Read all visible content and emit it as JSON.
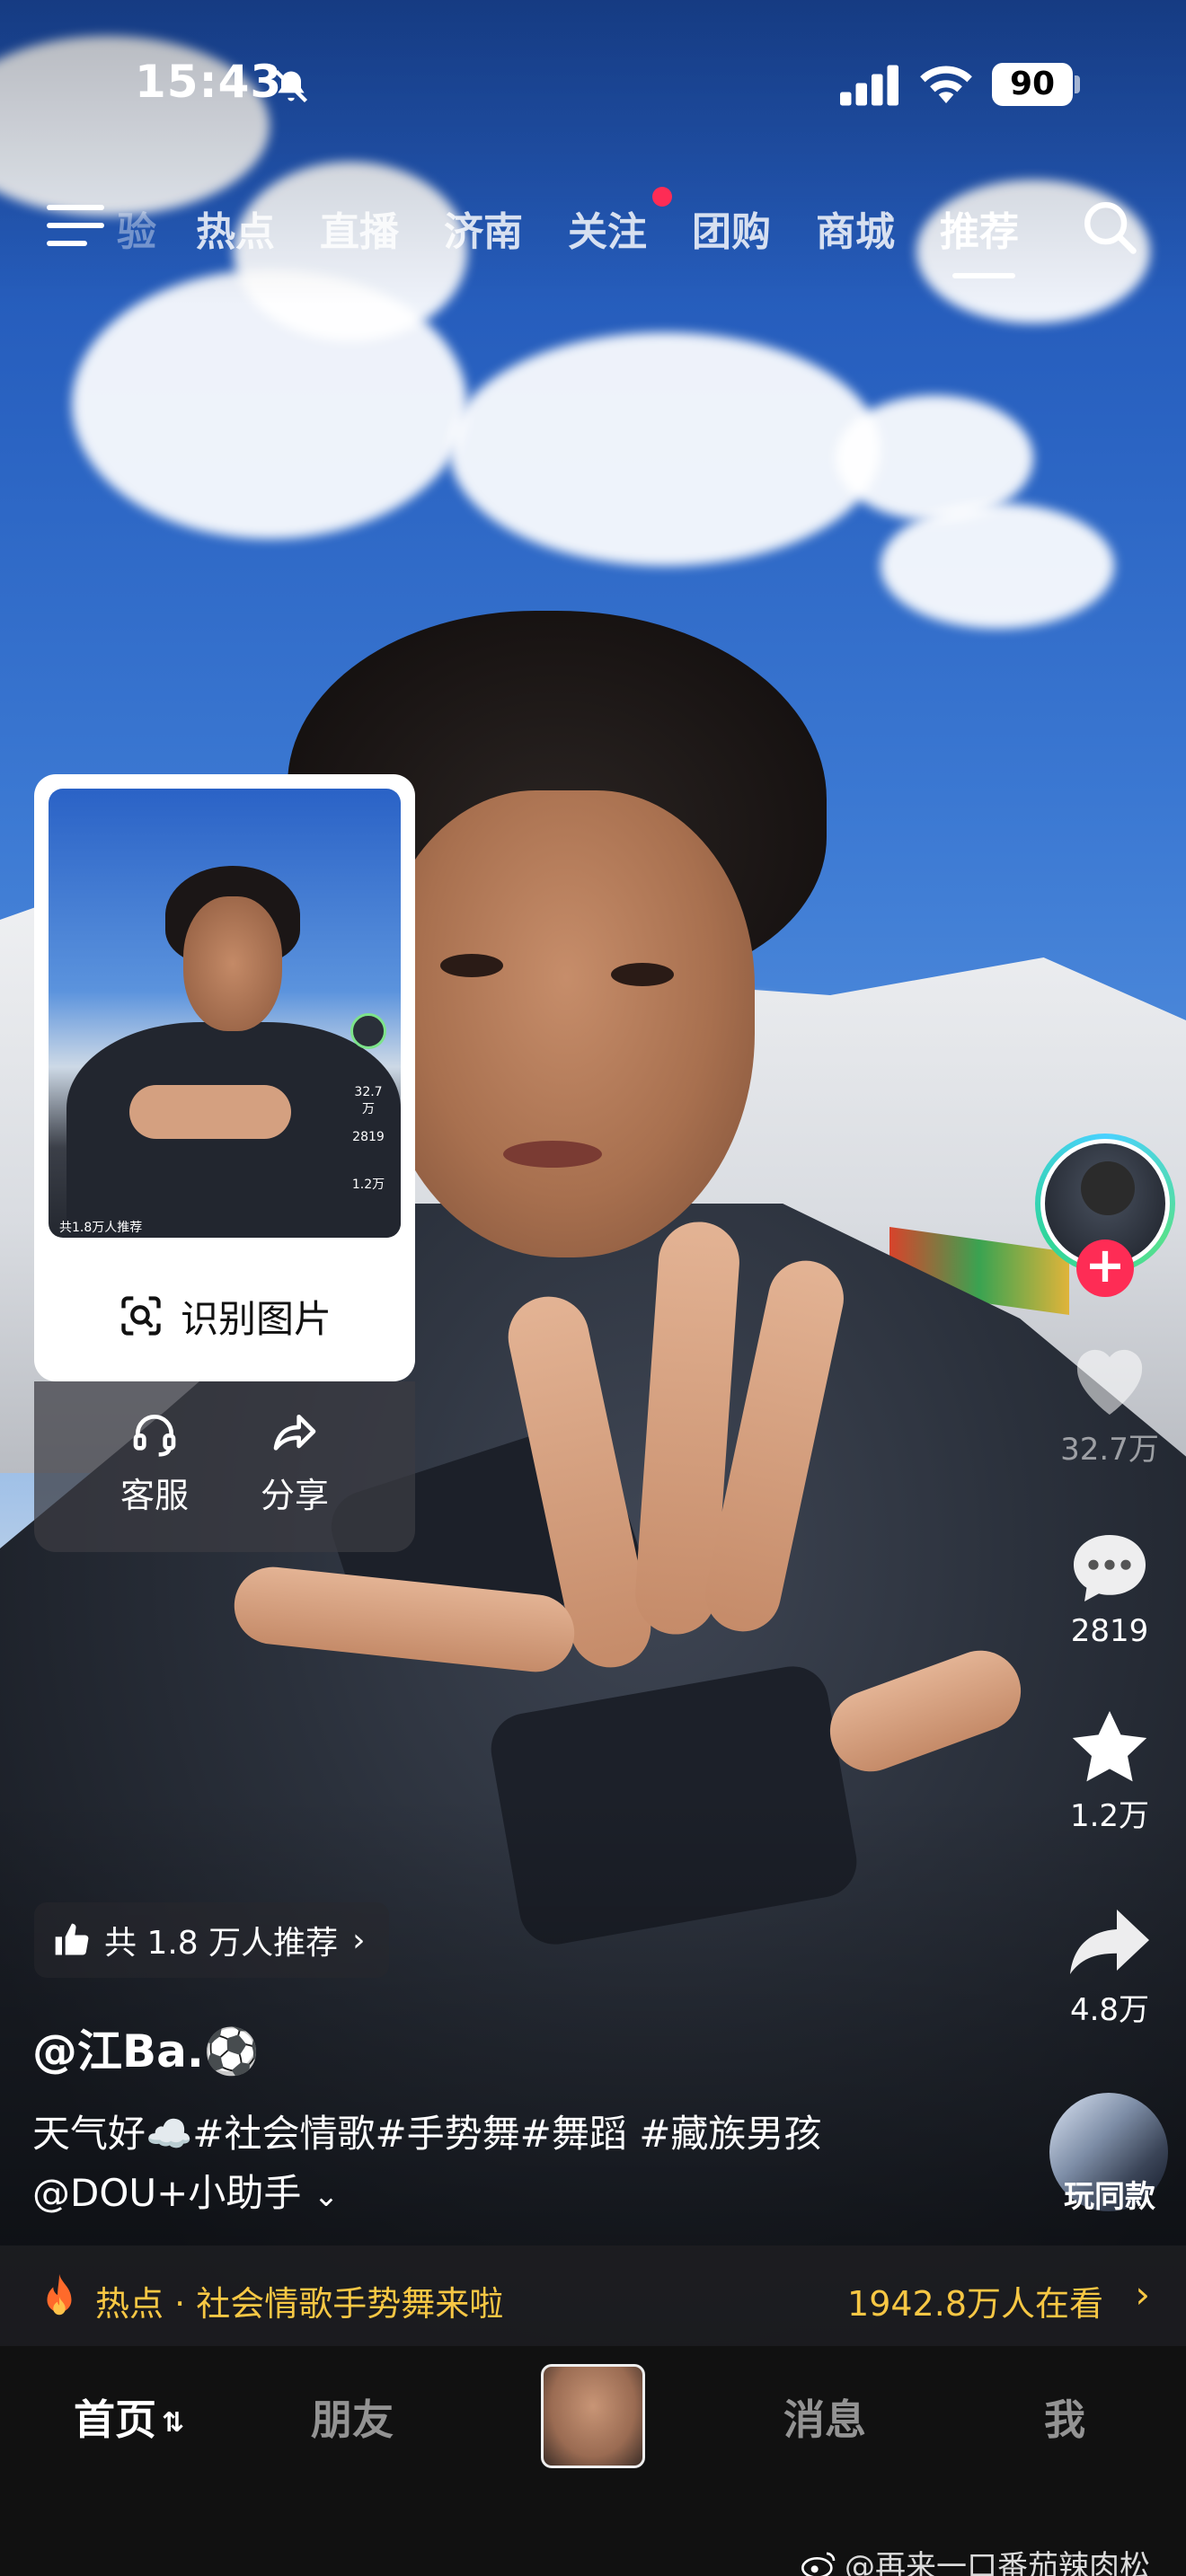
{
  "status_bar": {
    "time": "15:43",
    "battery": "90"
  },
  "top_nav": {
    "tabs": [
      {
        "label": "验",
        "active": false
      },
      {
        "label": "热点",
        "active": false
      },
      {
        "label": "直播",
        "active": false
      },
      {
        "label": "济南",
        "active": false
      },
      {
        "label": "关注",
        "active": false,
        "badge_dot": true
      },
      {
        "label": "团购",
        "active": false
      },
      {
        "label": "商城",
        "active": false
      },
      {
        "label": "推荐",
        "active": true
      }
    ]
  },
  "popup": {
    "thumbnail": {
      "likes": "32.7万",
      "comments": "2819",
      "favorites": "1.2万",
      "caption": "共1.8万人推荐"
    },
    "identify_label": "识别图片",
    "actions": [
      {
        "label": "客服",
        "icon": "headset-icon"
      },
      {
        "label": "分享",
        "icon": "share-icon"
      }
    ]
  },
  "right_rail": {
    "likes": "32.7万",
    "comments": "2819",
    "favorites": "1.2万",
    "shares": "4.8万",
    "same_model_label": "玩同款"
  },
  "video": {
    "recommend_text": "共 1.8 万人推荐",
    "author": "@江Ba.⚽",
    "caption": "天气好☁️#社会情歌#手势舞#舞蹈 #藏族男孩",
    "mention": "@DOU+小助手"
  },
  "hot_bar": {
    "text": "热点 · 社会情歌手势舞来啦",
    "viewers": "1942.8万人在看"
  },
  "bottom_tabs": {
    "home": "首页",
    "friends": "朋友",
    "messages": "消息",
    "me": "我"
  },
  "watermark": "@再来一口番茄辣肉松",
  "colors": {
    "accent_red": "#fe2c55",
    "hot_yellow": "#f7c744",
    "tabbar_bg": "#111111"
  }
}
